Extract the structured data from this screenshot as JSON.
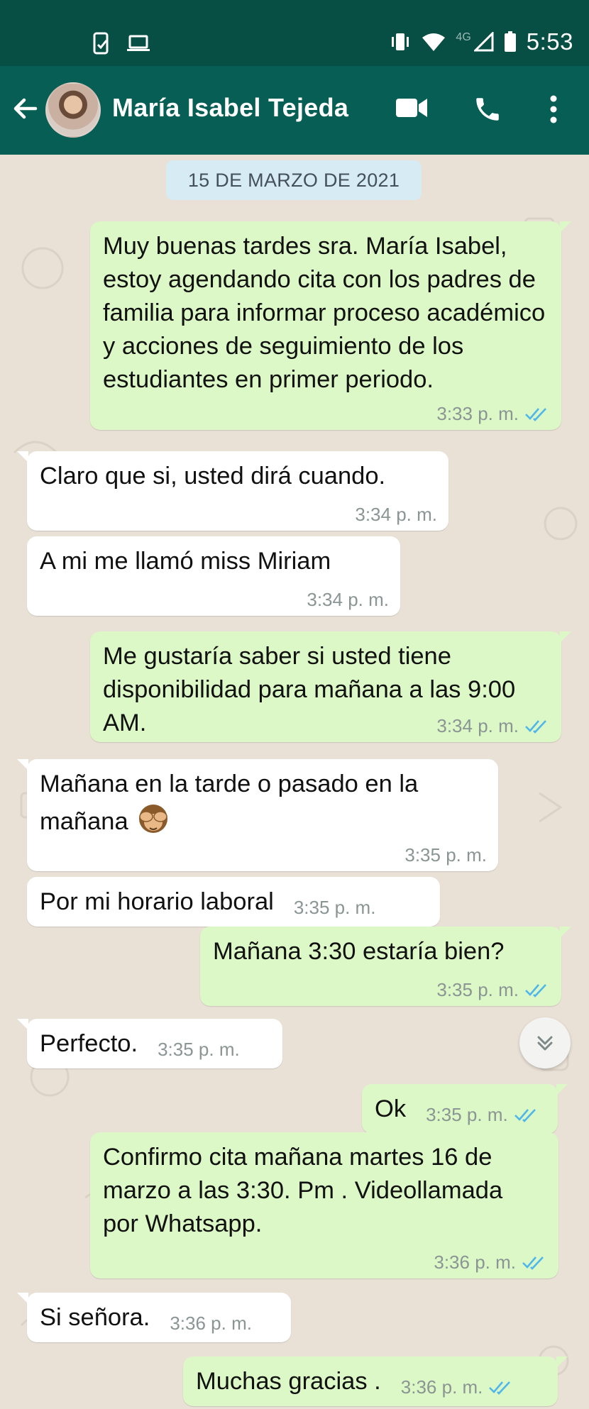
{
  "status_bar": {
    "time": "5:53",
    "network_label": "4G",
    "icons": [
      "phone-link-icon",
      "laptop-icon",
      "vibrate-icon",
      "wifi-icon",
      "signal-icon",
      "battery-icon"
    ]
  },
  "header": {
    "contact_name": "María Isabel Tejeda",
    "icons": [
      "back-arrow-icon",
      "video-call-icon",
      "phone-call-icon",
      "more-vert-icon"
    ],
    "color": "#075e54"
  },
  "chat": {
    "date_label": "15 DE MARZO DE 2021",
    "colors": {
      "incoming": "#ffffff",
      "outgoing": "#dcf8c6",
      "read_ticks": "#4fb6ec"
    },
    "messages": [
      {
        "dir": "out",
        "text": "Muy buenas tardes sra. María Isabel, estoy agendando cita con los padres de familia para informar proceso académico y acciones de seguimiento de los estudiantes en primer periodo.",
        "time": "3:33 p. m."
      },
      {
        "dir": "in",
        "text": "Claro que si, usted dirá cuando.",
        "time": "3:34 p. m."
      },
      {
        "dir": "in",
        "text": "A mi me llamó miss Miriam",
        "time": "3:34 p. m."
      },
      {
        "dir": "out",
        "text": "Me gustaría saber si usted tiene disponibilidad para mañana a las 9:00 AM.",
        "time": "3:34 p. m."
      },
      {
        "dir": "in",
        "text": "Mañana en la tarde o pasado en la mañana",
        "emoji": "see-no-evil-monkey",
        "time": "3:35 p. m."
      },
      {
        "dir": "in",
        "text": "Por mi horario laboral",
        "time": "3:35 p. m."
      },
      {
        "dir": "out",
        "text": "Mañana 3:30 estaría bien?",
        "time": "3:35 p. m."
      },
      {
        "dir": "in",
        "text": "Perfecto.",
        "time": "3:35 p. m."
      },
      {
        "dir": "out",
        "text": "Ok",
        "time": "3:35 p. m."
      },
      {
        "dir": "out",
        "text": "Confirmo cita mañana martes 16 de marzo a las 3:30. Pm . Videollamada por Whatsapp.",
        "time": "3:36 p. m."
      },
      {
        "dir": "in",
        "text": "Si señora.",
        "time": "3:36 p. m."
      },
      {
        "dir": "out",
        "text": "Muchas gracias .",
        "time": "3:36 p. m."
      }
    ]
  },
  "scroll_button": {
    "icon": "double-chevron-down-icon"
  }
}
